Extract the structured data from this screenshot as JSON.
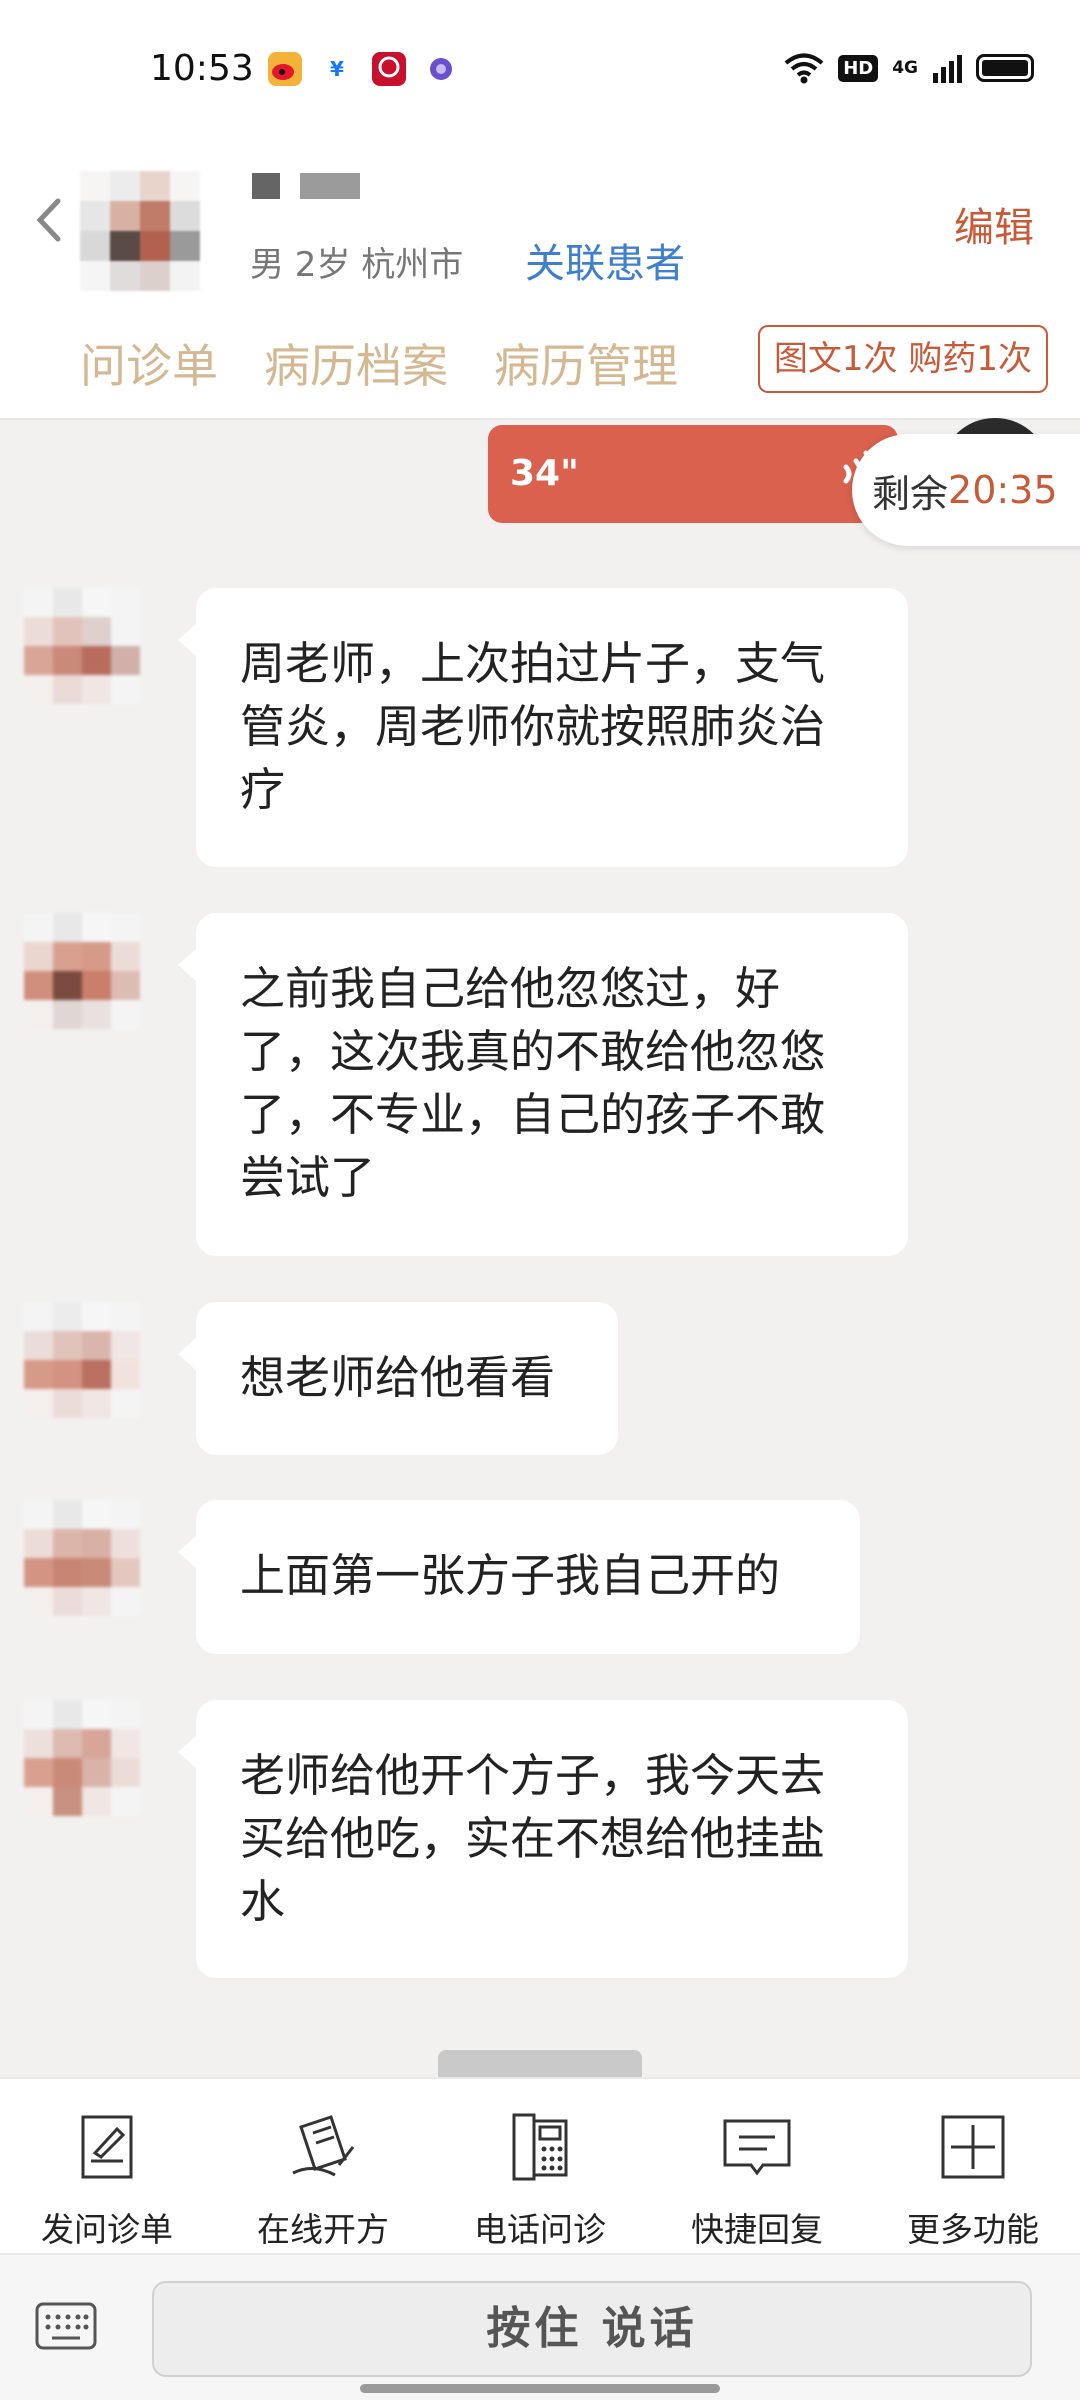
{
  "status_bar": {
    "time": "10:53",
    "net_label": "4G",
    "hd_label": "HD",
    "app_icons": [
      "weibo-icon",
      "alipay-icon",
      "app-red-icon",
      "app-purple-icon"
    ],
    "right_icons": [
      "wifi-icon",
      "signal-icon",
      "battery-icon"
    ]
  },
  "patient": {
    "meta": "男 2岁  杭州市",
    "link_label": "关联患者",
    "edit_label": "编辑"
  },
  "tabs": [
    {
      "label": "问诊单"
    },
    {
      "label": "病历档案"
    },
    {
      "label": "病历管理"
    }
  ],
  "consult_badge": "图文1次 购药1次",
  "voice_message": {
    "duration": "34\""
  },
  "remaining": {
    "label": "剩余",
    "time": "20:35"
  },
  "messages": [
    {
      "text": "周老师，上次拍过片子，支气管炎，周老师你就按照肺炎治疗"
    },
    {
      "text": "之前我自己给他忽悠过，好了，这次我真的不敢给他忽悠了，不专业，自己的孩子不敢尝试了"
    },
    {
      "text": "想老师给他看看"
    },
    {
      "text": "上面第一张方子我自己开的"
    },
    {
      "text": "老师给他开个方子，我今天去买给他吃，实在不想给他挂盐水"
    }
  ],
  "toolbar": [
    {
      "label": "发问诊单",
      "icon": "form-icon"
    },
    {
      "label": "在线开方",
      "icon": "prescription-icon"
    },
    {
      "label": "电话问诊",
      "icon": "phone-icon"
    },
    {
      "label": "快捷回复",
      "icon": "quick-reply-icon"
    },
    {
      "label": "更多功能",
      "icon": "plus-icon"
    }
  ],
  "input": {
    "push_to_talk": "按住 说话"
  },
  "colors": {
    "accent": "#c85a38",
    "link": "#3f7fd0",
    "tab": "#d4b892",
    "voice_bubble": "#d9614d"
  }
}
